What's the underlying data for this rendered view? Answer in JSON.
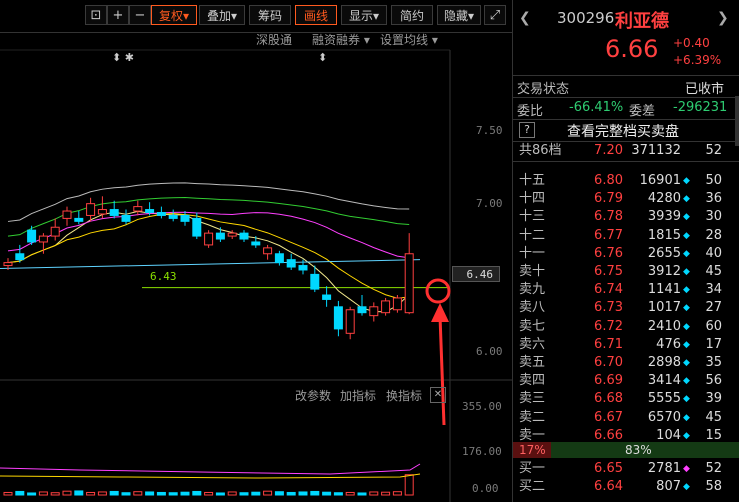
{
  "toolbar": {
    "buttons": [
      "复权",
      "叠加",
      "筹码",
      "画线",
      "显示",
      "简约",
      "隐藏"
    ],
    "icons": [
      "lock-icon",
      "zoom-in-icon",
      "zoom-out-icon",
      "fullscreen-icon"
    ]
  },
  "subbar": {
    "links": [
      "深股通",
      "融资融券",
      "设置均线"
    ]
  },
  "markers": {
    "top1": "⬍ ✱",
    "top2": "⬍"
  },
  "price_axis": [
    "7.50",
    "7.00",
    "6.46",
    "6.00"
  ],
  "line_label": "6.43",
  "indicator_bar": {
    "links": [
      "改参数",
      "加指标",
      "换指标"
    ],
    "close": "✕"
  },
  "volume_axis": [
    "355.00",
    "176.00",
    "0.00"
  ],
  "stock": {
    "code": "300296",
    "name": "利亚德",
    "price": "6.66",
    "change": "+0.40",
    "change_pct": "+6.39%",
    "status_label": "交易状态",
    "status_value": "已收市",
    "ratio_label": "委比",
    "ratio_value": "-66.41%",
    "diff_label": "委差",
    "diff_value": "-296231",
    "help": "?",
    "full_book_link": "查看完整档买卖盘",
    "total_levels": "共86档",
    "total_price": "7.20",
    "total_volume": "371132",
    "total_count": "52"
  },
  "sell_orders": [
    {
      "label": "十五",
      "price": "6.80",
      "volume": "16901",
      "count": "50"
    },
    {
      "label": "十四",
      "price": "6.79",
      "volume": "4280",
      "count": "36"
    },
    {
      "label": "十三",
      "price": "6.78",
      "volume": "3939",
      "count": "30"
    },
    {
      "label": "十二",
      "price": "6.77",
      "volume": "1815",
      "count": "28"
    },
    {
      "label": "十一",
      "price": "6.76",
      "volume": "2655",
      "count": "40"
    },
    {
      "label": "卖十",
      "price": "6.75",
      "volume": "3912",
      "count": "45"
    },
    {
      "label": "卖九",
      "price": "6.74",
      "volume": "1141",
      "count": "34"
    },
    {
      "label": "卖八",
      "price": "6.73",
      "volume": "1017",
      "count": "27"
    },
    {
      "label": "卖七",
      "price": "6.72",
      "volume": "2410",
      "count": "60"
    },
    {
      "label": "卖六",
      "price": "6.71",
      "volume": "476",
      "count": "17"
    },
    {
      "label": "卖五",
      "price": "6.70",
      "volume": "2898",
      "count": "35"
    },
    {
      "label": "卖四",
      "price": "6.69",
      "volume": "3414",
      "count": "56"
    },
    {
      "label": "卖三",
      "price": "6.68",
      "volume": "5555",
      "count": "39"
    },
    {
      "label": "卖二",
      "price": "6.67",
      "volume": "6570",
      "count": "45"
    },
    {
      "label": "卖一",
      "price": "6.66",
      "volume": "104",
      "count": "15"
    }
  ],
  "ratio_bar": {
    "left": "17%",
    "right": "83%"
  },
  "buy_orders": [
    {
      "label": "买一",
      "price": "6.65",
      "volume": "2781",
      "count": "52"
    },
    {
      "label": "买二",
      "price": "6.64",
      "volume": "807",
      "count": "58"
    }
  ],
  "colors": {
    "up": "#ff4040",
    "down": "#00d8ff",
    "accent": "#ff5a1f"
  },
  "chart_data": {
    "type": "candlestick",
    "yticks": [
      "7.50",
      "7.00",
      "6.46",
      "6.00"
    ],
    "current_price_label": "6.46",
    "support_line_label": "6.43",
    "volume_ticks": [
      "355.00",
      "176.00",
      "0.00"
    ],
    "candles": [
      {
        "o": 6.58,
        "h": 6.63,
        "l": 6.55,
        "c": 6.6
      },
      {
        "o": 6.66,
        "h": 6.72,
        "l": 6.6,
        "c": 6.62
      },
      {
        "o": 6.82,
        "h": 6.85,
        "l": 6.72,
        "c": 6.74
      },
      {
        "o": 6.74,
        "h": 6.8,
        "l": 6.66,
        "c": 6.78
      },
      {
        "o": 6.78,
        "h": 6.9,
        "l": 6.75,
        "c": 6.84
      },
      {
        "o": 6.9,
        "h": 6.98,
        "l": 6.85,
        "c": 6.95
      },
      {
        "o": 6.9,
        "h": 6.95,
        "l": 6.86,
        "c": 6.88
      },
      {
        "o": 6.92,
        "h": 7.04,
        "l": 6.88,
        "c": 7.0
      },
      {
        "o": 6.93,
        "h": 7.05,
        "l": 6.9,
        "c": 6.96
      },
      {
        "o": 6.96,
        "h": 7.02,
        "l": 6.9,
        "c": 6.92
      },
      {
        "o": 6.92,
        "h": 6.96,
        "l": 6.86,
        "c": 6.88
      },
      {
        "o": 6.95,
        "h": 7.02,
        "l": 6.92,
        "c": 6.98
      },
      {
        "o": 6.96,
        "h": 7.01,
        "l": 6.92,
        "c": 6.94
      },
      {
        "o": 6.94,
        "h": 6.98,
        "l": 6.9,
        "c": 6.92
      },
      {
        "o": 6.92,
        "h": 6.96,
        "l": 6.88,
        "c": 6.9
      },
      {
        "o": 6.92,
        "h": 6.95,
        "l": 6.85,
        "c": 6.88
      },
      {
        "o": 6.9,
        "h": 6.94,
        "l": 6.76,
        "c": 6.78
      },
      {
        "o": 6.72,
        "h": 6.82,
        "l": 6.7,
        "c": 6.8
      },
      {
        "o": 6.8,
        "h": 6.84,
        "l": 6.74,
        "c": 6.76
      },
      {
        "o": 6.78,
        "h": 6.82,
        "l": 6.76,
        "c": 6.8
      },
      {
        "o": 6.8,
        "h": 6.82,
        "l": 6.74,
        "c": 6.76
      },
      {
        "o": 6.74,
        "h": 6.78,
        "l": 6.7,
        "c": 6.72
      },
      {
        "o": 6.66,
        "h": 6.72,
        "l": 6.62,
        "c": 6.7
      },
      {
        "o": 6.66,
        "h": 6.68,
        "l": 6.58,
        "c": 6.6
      },
      {
        "o": 6.62,
        "h": 6.66,
        "l": 6.55,
        "c": 6.57
      },
      {
        "o": 6.58,
        "h": 6.62,
        "l": 6.52,
        "c": 6.55
      },
      {
        "o": 6.52,
        "h": 6.58,
        "l": 6.4,
        "c": 6.42
      },
      {
        "o": 6.38,
        "h": 6.44,
        "l": 6.3,
        "c": 6.35
      },
      {
        "o": 6.3,
        "h": 6.34,
        "l": 6.1,
        "c": 6.15
      },
      {
        "o": 6.12,
        "h": 6.3,
        "l": 6.08,
        "c": 6.28
      },
      {
        "o": 6.3,
        "h": 6.38,
        "l": 6.24,
        "c": 6.26
      },
      {
        "o": 6.24,
        "h": 6.33,
        "l": 6.2,
        "c": 6.3
      },
      {
        "o": 6.26,
        "h": 6.36,
        "l": 6.24,
        "c": 6.34
      },
      {
        "o": 6.28,
        "h": 6.38,
        "l": 6.26,
        "c": 6.36
      },
      {
        "o": 6.26,
        "h": 6.8,
        "l": 6.25,
        "c": 6.66
      }
    ],
    "volumes": [
      10,
      14,
      8,
      12,
      9,
      15,
      16,
      10,
      12,
      14,
      9,
      13,
      12,
      10,
      9,
      11,
      14,
      10,
      8,
      12,
      9,
      11,
      15,
      13,
      10,
      12,
      14,
      11,
      9,
      10,
      8,
      12,
      11,
      13,
      80
    ]
  }
}
